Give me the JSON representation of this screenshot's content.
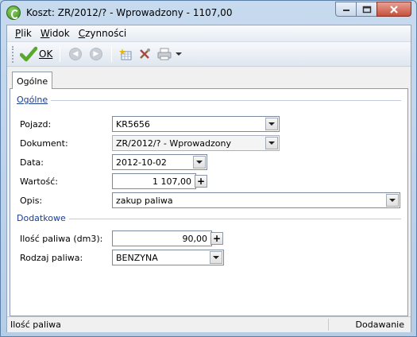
{
  "window": {
    "title": "Koszt: ZR/2012/? - Wprowadzony - 1107,00"
  },
  "menu": {
    "plik": "lik",
    "plik_u": "P",
    "widok": "idok",
    "widok_u": "W",
    "czynnosci": "zynności",
    "czynnosci_u": "C"
  },
  "toolbar": {
    "ok_label": "OK"
  },
  "tabs": {
    "ogolne": "Ogólne"
  },
  "group_general": {
    "title": "Ogólne",
    "pojazd_label": "Pojazd:",
    "pojazd_value": "KR5656",
    "dokument_label": "Dokument:",
    "dokument_value": "ZR/2012/? - Wprowadzony",
    "data_label": "Data:",
    "data_value": "2012-10-02",
    "wartosc_label": "Wartość:",
    "wartosc_value": "1 107,00",
    "opis_label": "Opis:",
    "opis_value": "zakup paliwa"
  },
  "group_extra": {
    "title": "Dodatkowe",
    "ilosc_label": "Ilość paliwa (dm3):",
    "ilosc_value": "90,00",
    "rodzaj_label": "Rodzaj paliwa:",
    "rodzaj_value": "BENZYNA"
  },
  "status": {
    "left": "Ilość paliwa",
    "right": "Dodawanie"
  },
  "icons": {
    "app": "app-icon",
    "ok": "checkmark-icon",
    "back": "back-arrow-icon",
    "forward": "forward-arrow-icon",
    "grid": "grid-star-icon",
    "tools": "tools-icon",
    "print": "printer-icon"
  }
}
